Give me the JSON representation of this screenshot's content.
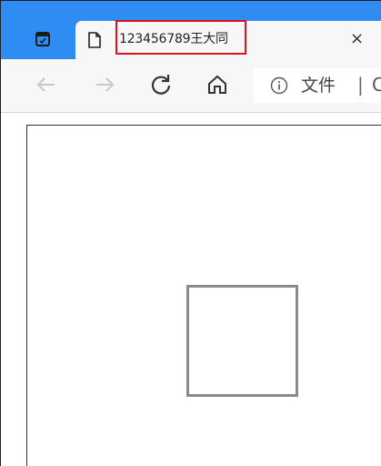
{
  "tab": {
    "title": "123456789王大同",
    "close_glyph": "×",
    "page_icon": "page-icon"
  },
  "window": {
    "icon": "tab-actions-icon"
  },
  "toolbar": {
    "back_icon": "arrow-left-icon",
    "forward_icon": "arrow-right-icon",
    "reload_icon": "reload-icon",
    "home_icon": "home-icon"
  },
  "address": {
    "info_icon": "info-icon",
    "scheme_label": "文件",
    "separator": "|",
    "url_fragment": "C"
  },
  "colors": {
    "titlebar": "#2f8cf3",
    "highlight_border": "#e0101f",
    "toolbar": "#f7f7f7",
    "square_border": "#8a8a8a"
  }
}
